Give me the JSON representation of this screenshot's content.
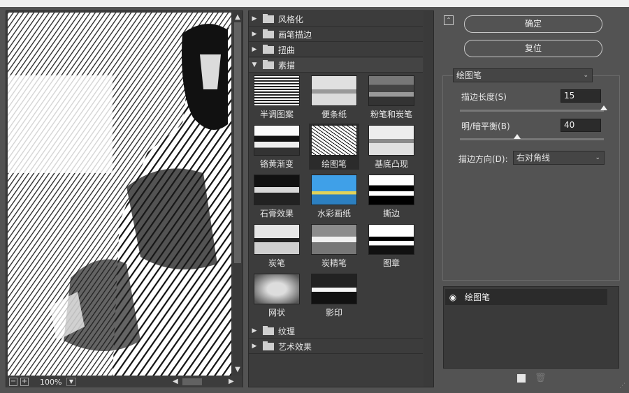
{
  "preview": {
    "zoom": "100%",
    "minus_label": "−",
    "plus_label": "+"
  },
  "gallery": {
    "categories_top": [
      {
        "label": "风格化",
        "open": false
      },
      {
        "label": "画笔描边",
        "open": false
      },
      {
        "label": "扭曲",
        "open": false
      },
      {
        "label": "素描",
        "open": true
      }
    ],
    "filters": [
      {
        "label": "半调图案"
      },
      {
        "label": "便条纸"
      },
      {
        "label": "粉笔和炭笔"
      },
      {
        "label": "铬黄渐变"
      },
      {
        "label": "绘图笔",
        "selected": true
      },
      {
        "label": "基底凸现"
      },
      {
        "label": "石膏效果"
      },
      {
        "label": "水彩画纸"
      },
      {
        "label": "撕边"
      },
      {
        "label": "炭笔"
      },
      {
        "label": "炭精笔"
      },
      {
        "label": "图章"
      },
      {
        "label": "网状"
      },
      {
        "label": "影印"
      }
    ],
    "categories_bottom": [
      {
        "label": "纹理"
      },
      {
        "label": "艺术效果"
      }
    ]
  },
  "buttons": {
    "ok": "确定",
    "reset": "复位"
  },
  "settings": {
    "filter_select": "绘图笔",
    "stroke_length_label": "描边长度(S)",
    "stroke_length_value": "15",
    "stroke_length_fraction": 1.0,
    "balance_label": "明/暗平衡(B)",
    "balance_value": "40",
    "balance_fraction": 0.4,
    "direction_label": "描边方向(D):",
    "direction_value": "右对角线"
  },
  "layers": {
    "items": [
      {
        "label": "绘图笔"
      }
    ]
  },
  "colors": {
    "panel": "#3c3c3c",
    "background": "#535353",
    "selected": "#2b2b2b"
  }
}
